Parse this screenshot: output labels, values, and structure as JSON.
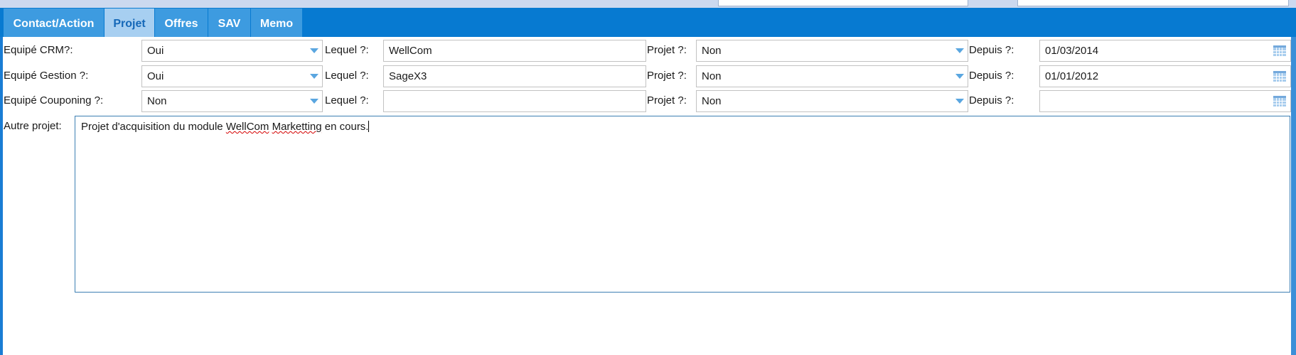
{
  "tabs": [
    {
      "label": "Contact/Action",
      "active": false
    },
    {
      "label": "Projet",
      "active": true
    },
    {
      "label": "Offres",
      "active": false
    },
    {
      "label": "SAV",
      "active": false
    },
    {
      "label": "Memo",
      "active": false
    }
  ],
  "rows": [
    {
      "equip_label": "Equipé CRM?:",
      "equip_value": "Oui",
      "lequel_label": "Lequel ?:",
      "lequel_value": "WellCom",
      "projet_label": "Projet ?:",
      "projet_value": "Non",
      "depuis_label": "Depuis ?:",
      "depuis_value": "01/03/2014"
    },
    {
      "equip_label": "Equipé Gestion ?:",
      "equip_value": "Oui",
      "lequel_label": "Lequel ?:",
      "lequel_value": "SageX3",
      "projet_label": "Projet ?:",
      "projet_value": "Non",
      "depuis_label": "Depuis ?:",
      "depuis_value": "01/01/2012"
    },
    {
      "equip_label": "Equipé Couponing ?:",
      "equip_value": "Non",
      "lequel_label": "Lequel ?:",
      "lequel_value": "",
      "projet_label": "Projet ?:",
      "projet_value": "Non",
      "depuis_label": "Depuis ?:",
      "depuis_value": ""
    }
  ],
  "autre_projet": {
    "label": "Autre projet:",
    "text_part1": "Projet d'acquisition du module ",
    "word1": "WellCom",
    "text_part2": " ",
    "word2": "Marketting",
    "text_part3": " en cours."
  },
  "colors": {
    "tabbar": "#077ad1",
    "tab": "#3d9be0",
    "tab_active": "#a7cff1",
    "arrow": "#5aa6e0"
  },
  "icons": {
    "combo": "chevron-down-icon",
    "date": "calendar-icon"
  }
}
